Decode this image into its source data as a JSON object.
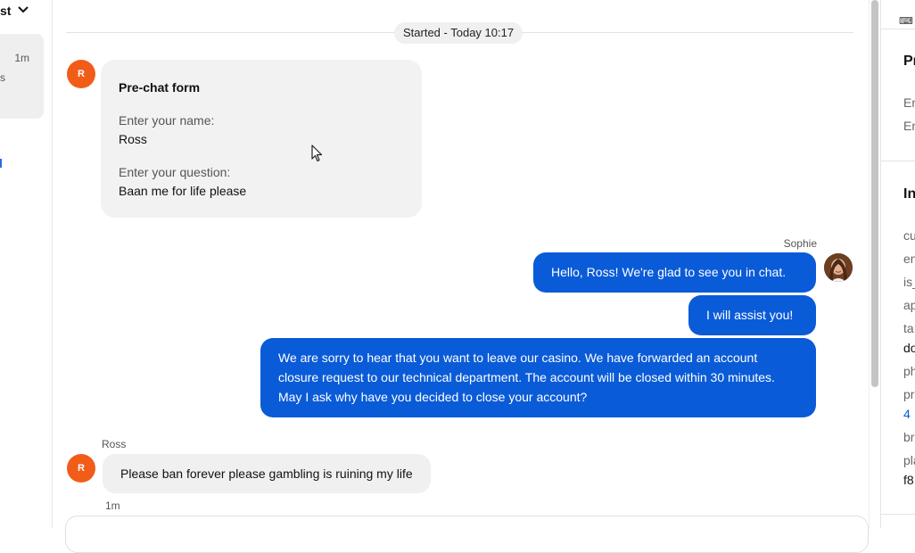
{
  "sidebar": {
    "header_fragment": "st",
    "conversation": {
      "time": "1m",
      "snippet_fragment": "s"
    }
  },
  "chat": {
    "started_label": "Started - Today 10:17",
    "customer_initial": "R",
    "prechat": {
      "title": "Pre-chat form",
      "fields": [
        {
          "question": "Enter your name:",
          "answer": "Ross"
        },
        {
          "question": "Enter your question:",
          "answer": "Baan me for life please"
        }
      ]
    },
    "agent_name": "Sophie",
    "agent_messages": [
      "Hello, Ross! We're glad to see you in chat.",
      "I will assist you!",
      "We are sorry to hear that you want to leave our casino. We have forwarded an account closure request to our technical department. The account will be closed within 30 minutes. May I ask why have you decided to close your account?"
    ],
    "customer_name": "Ross",
    "customer_message": "Please ban forever please gambling is ruining my life",
    "customer_message_time": "1m"
  },
  "right_panel": {
    "keyboard_icon": "⌨",
    "section1_title_fragment": "Pr",
    "section1_rows": [
      "En",
      "En"
    ],
    "section2_title_fragment": "In",
    "fields": [
      {
        "key": "cu"
      },
      {
        "key": "en"
      },
      {
        "key": "is_"
      },
      {
        "key": "ap"
      },
      {
        "key": "ta",
        "value": "do"
      },
      {
        "key": "ph"
      },
      {
        "key": "pr",
        "value": "4"
      },
      {
        "key": "br"
      },
      {
        "key": "pla",
        "value": "f8"
      }
    ]
  },
  "colors": {
    "agent_bubble": "#0a5bd8",
    "customer_avatar": "#f25c19",
    "customer_bubble": "#f0f0f0"
  }
}
